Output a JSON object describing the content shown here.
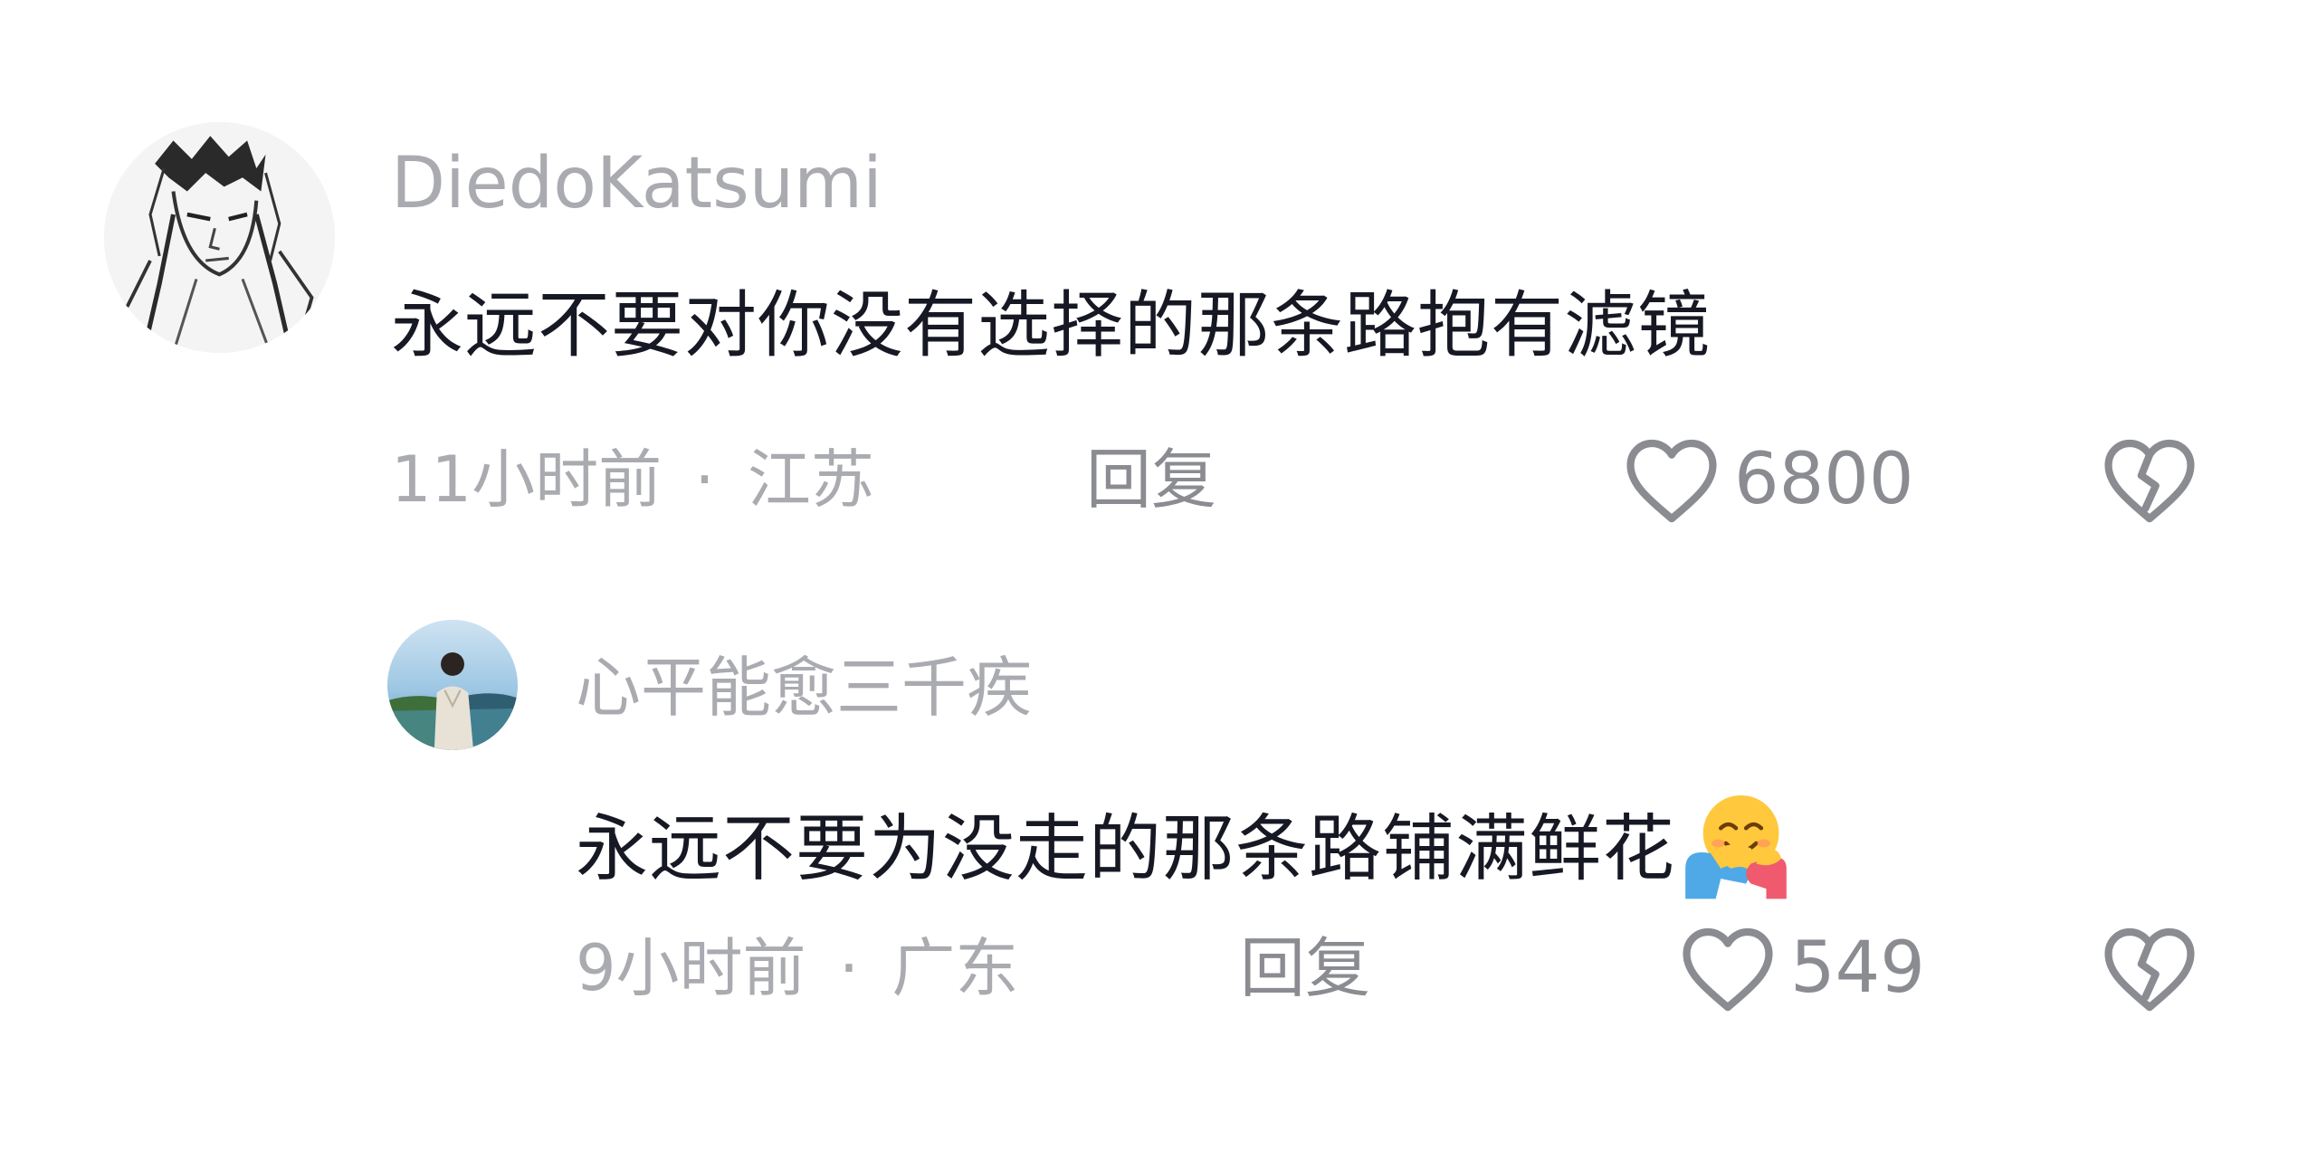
{
  "comments": [
    {
      "username": "DiedoKatsumi",
      "text": "永远不要对你没有选择的那条路抱有滤镜",
      "time": "11小时前",
      "separator": "·",
      "location": "江苏",
      "reply_label": "回复",
      "likes": "6800",
      "avatar_icon": "sketch-man-avatar",
      "like_icon": "heart-outline-icon",
      "dislike_icon": "broken-heart-icon"
    }
  ],
  "replies": [
    {
      "username": "心平能愈三千疾",
      "text": "永远不要为没走的那条路铺满鲜花",
      "emoji": "hugging-face-emoji",
      "time": "9小时前",
      "separator": "·",
      "location": "广东",
      "reply_label": "回复",
      "likes": "549",
      "avatar_icon": "seaside-person-avatar",
      "like_icon": "heart-outline-icon",
      "dislike_icon": "broken-heart-icon"
    }
  ],
  "colors": {
    "text_primary": "#161823",
    "text_secondary": "#a9abb0",
    "icon": "#8a8c91"
  }
}
